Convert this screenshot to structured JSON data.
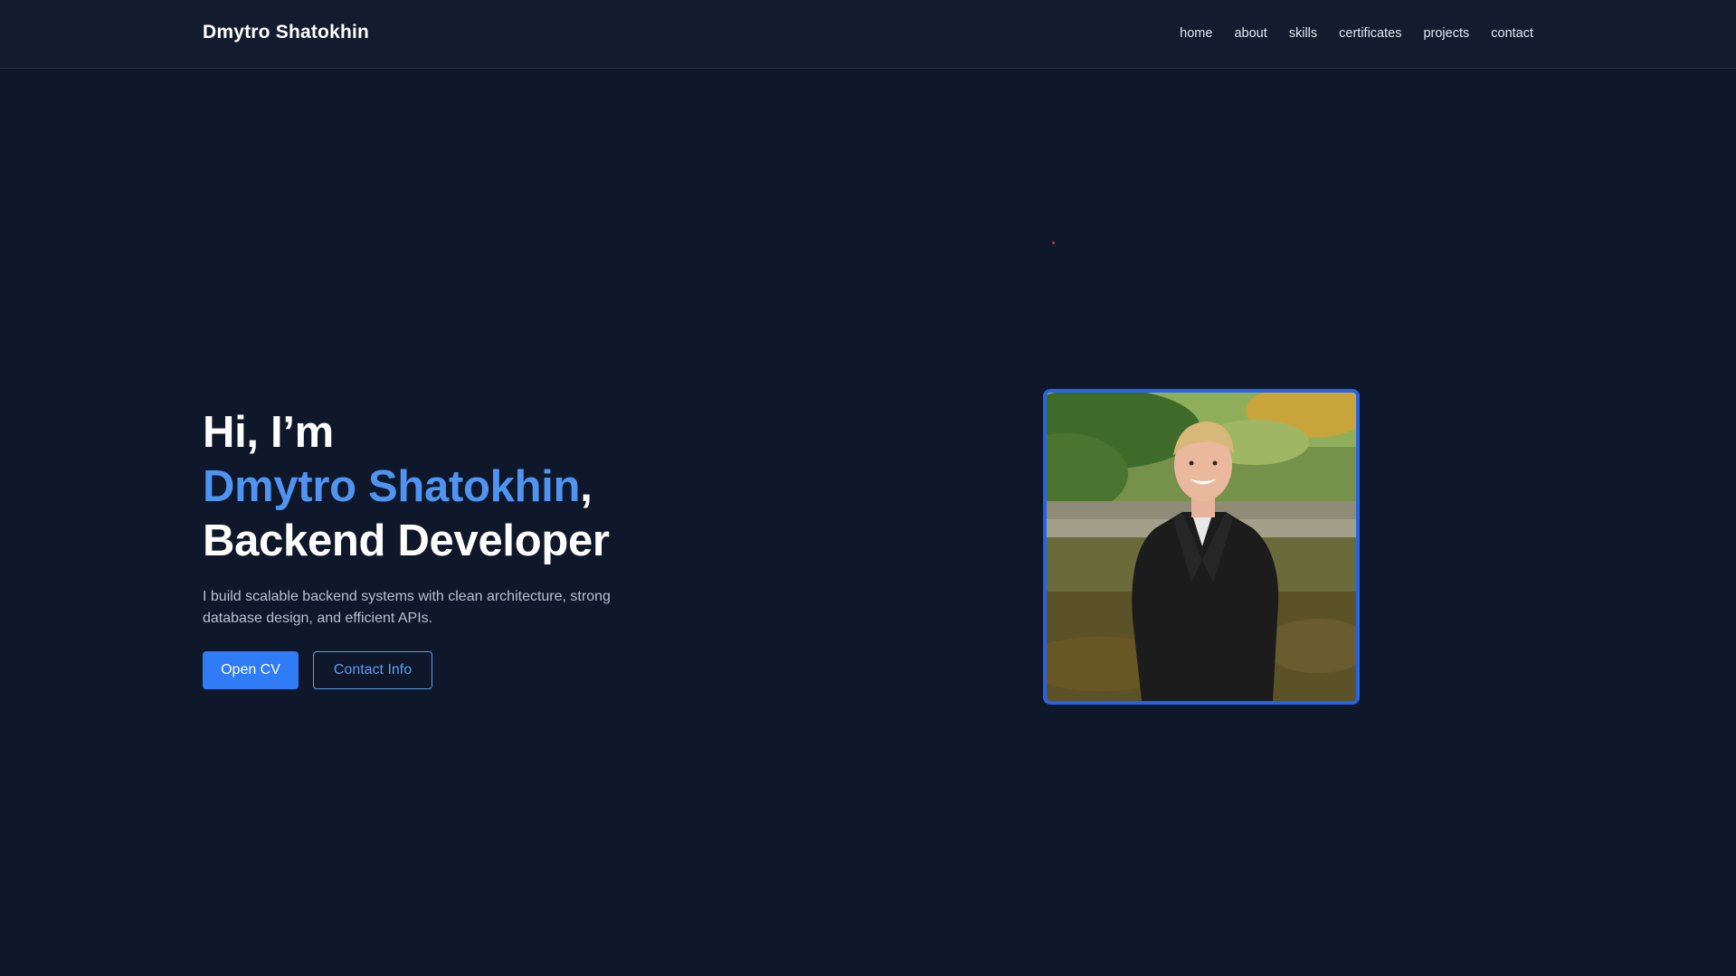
{
  "brand": "Dmytro Shatokhin",
  "nav": [
    "home",
    "about",
    "skills",
    "certificates",
    "projects",
    "contact"
  ],
  "hero": {
    "greeting": "Hi, I’m",
    "name": "Dmytro Shatokhin",
    "name_suffix": ",",
    "role": "Backend Developer",
    "tagline": "I build scalable backend systems with clean architecture, strong database design, and efficient APIs.",
    "primary_button": "Open CV",
    "secondary_button": "Contact Info"
  },
  "colors": {
    "background": "#0f172a",
    "navbar": "#131b2e",
    "accent": "#4f94f0",
    "button_primary": "#2f7cf6",
    "photo_border": "#2563eb"
  }
}
